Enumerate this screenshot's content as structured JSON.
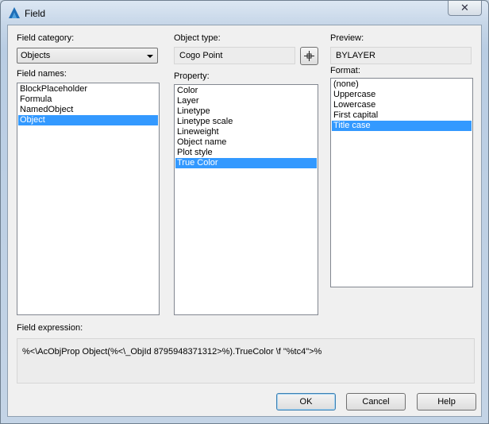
{
  "window": {
    "title": "Field"
  },
  "field_category": {
    "label": "Field category:",
    "value": "Objects"
  },
  "field_names": {
    "label": "Field names:",
    "items": [
      "BlockPlaceholder",
      "Formula",
      "NamedObject",
      "Object"
    ],
    "selected": "Object"
  },
  "object_type": {
    "label": "Object type:",
    "value": "Cogo Point"
  },
  "property": {
    "label": "Property:",
    "items": [
      "Color",
      "Layer",
      "Linetype",
      "Linetype scale",
      "Lineweight",
      "Object name",
      "Plot style",
      "True Color"
    ],
    "selected": "True Color"
  },
  "preview": {
    "label": "Preview:",
    "value": "BYLAYER"
  },
  "format": {
    "label": "Format:",
    "items": [
      "(none)",
      "Uppercase",
      "Lowercase",
      "First capital",
      "Title case"
    ],
    "selected": "Title case"
  },
  "field_expression": {
    "label": "Field expression:",
    "value": "%<\\AcObjProp Object(%<\\_ObjId 8795948371312>%).TrueColor \\f \"%tc4\">%"
  },
  "buttons": {
    "ok": "OK",
    "cancel": "Cancel",
    "help": "Help"
  },
  "icons": {
    "app": "autocad-logo-icon",
    "close": "close-icon",
    "pick": "crosshair-pick-icon"
  },
  "colors": {
    "selection": "#3399ff"
  }
}
